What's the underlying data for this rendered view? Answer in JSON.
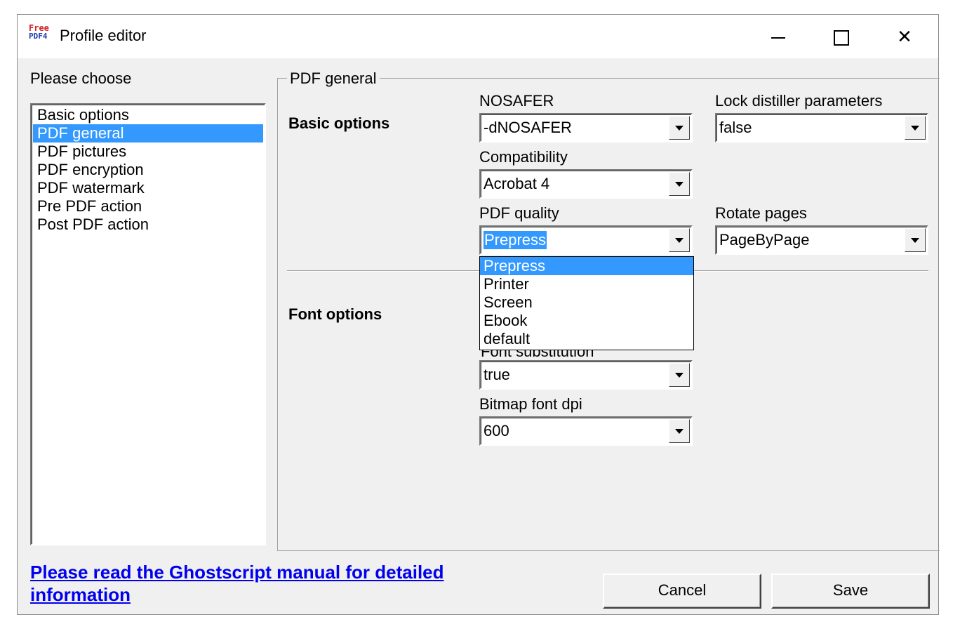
{
  "window": {
    "title": "Profile editor",
    "logo_line1": "Free",
    "logo_line2": "PDF4"
  },
  "sidebar": {
    "heading": "Please choose",
    "items": [
      {
        "label": "Basic options",
        "selected": false
      },
      {
        "label": "PDF general",
        "selected": true
      },
      {
        "label": "PDF pictures",
        "selected": false
      },
      {
        "label": "PDF encryption",
        "selected": false
      },
      {
        "label": "PDF watermark",
        "selected": false
      },
      {
        "label": "Pre PDF action",
        "selected": false
      },
      {
        "label": "Post PDF action",
        "selected": false
      }
    ]
  },
  "group": {
    "legend": "PDF general",
    "basic_title": "Basic options",
    "font_title": "Font options"
  },
  "fields": {
    "nosafer": {
      "label": "NOSAFER",
      "value": "-dNOSAFER"
    },
    "lock_distiller": {
      "label": "Lock distiller parameters",
      "value": "false"
    },
    "compatibility": {
      "label": "Compatibility",
      "value": "Acrobat 4"
    },
    "pdf_quality": {
      "label": "PDF quality",
      "value": "Prepress"
    },
    "rotate_pages": {
      "label": "Rotate pages",
      "value": "PageByPage"
    },
    "font_substitution": {
      "label": "Font substitution",
      "value": "true"
    },
    "bitmap_font_dpi": {
      "label": "Bitmap font dpi",
      "value": "600"
    }
  },
  "quality_dropdown": {
    "options": [
      "Prepress",
      "Printer",
      "Screen",
      "Ebook",
      "default"
    ],
    "selected": "Prepress"
  },
  "footer": {
    "link_text": "Please read the Ghostscript manual for detailed information",
    "cancel_label": "Cancel",
    "save_label": "Save"
  },
  "colors": {
    "selection": "#3399ff",
    "link": "#0000ee",
    "window_bg": "#f0f0f0"
  }
}
